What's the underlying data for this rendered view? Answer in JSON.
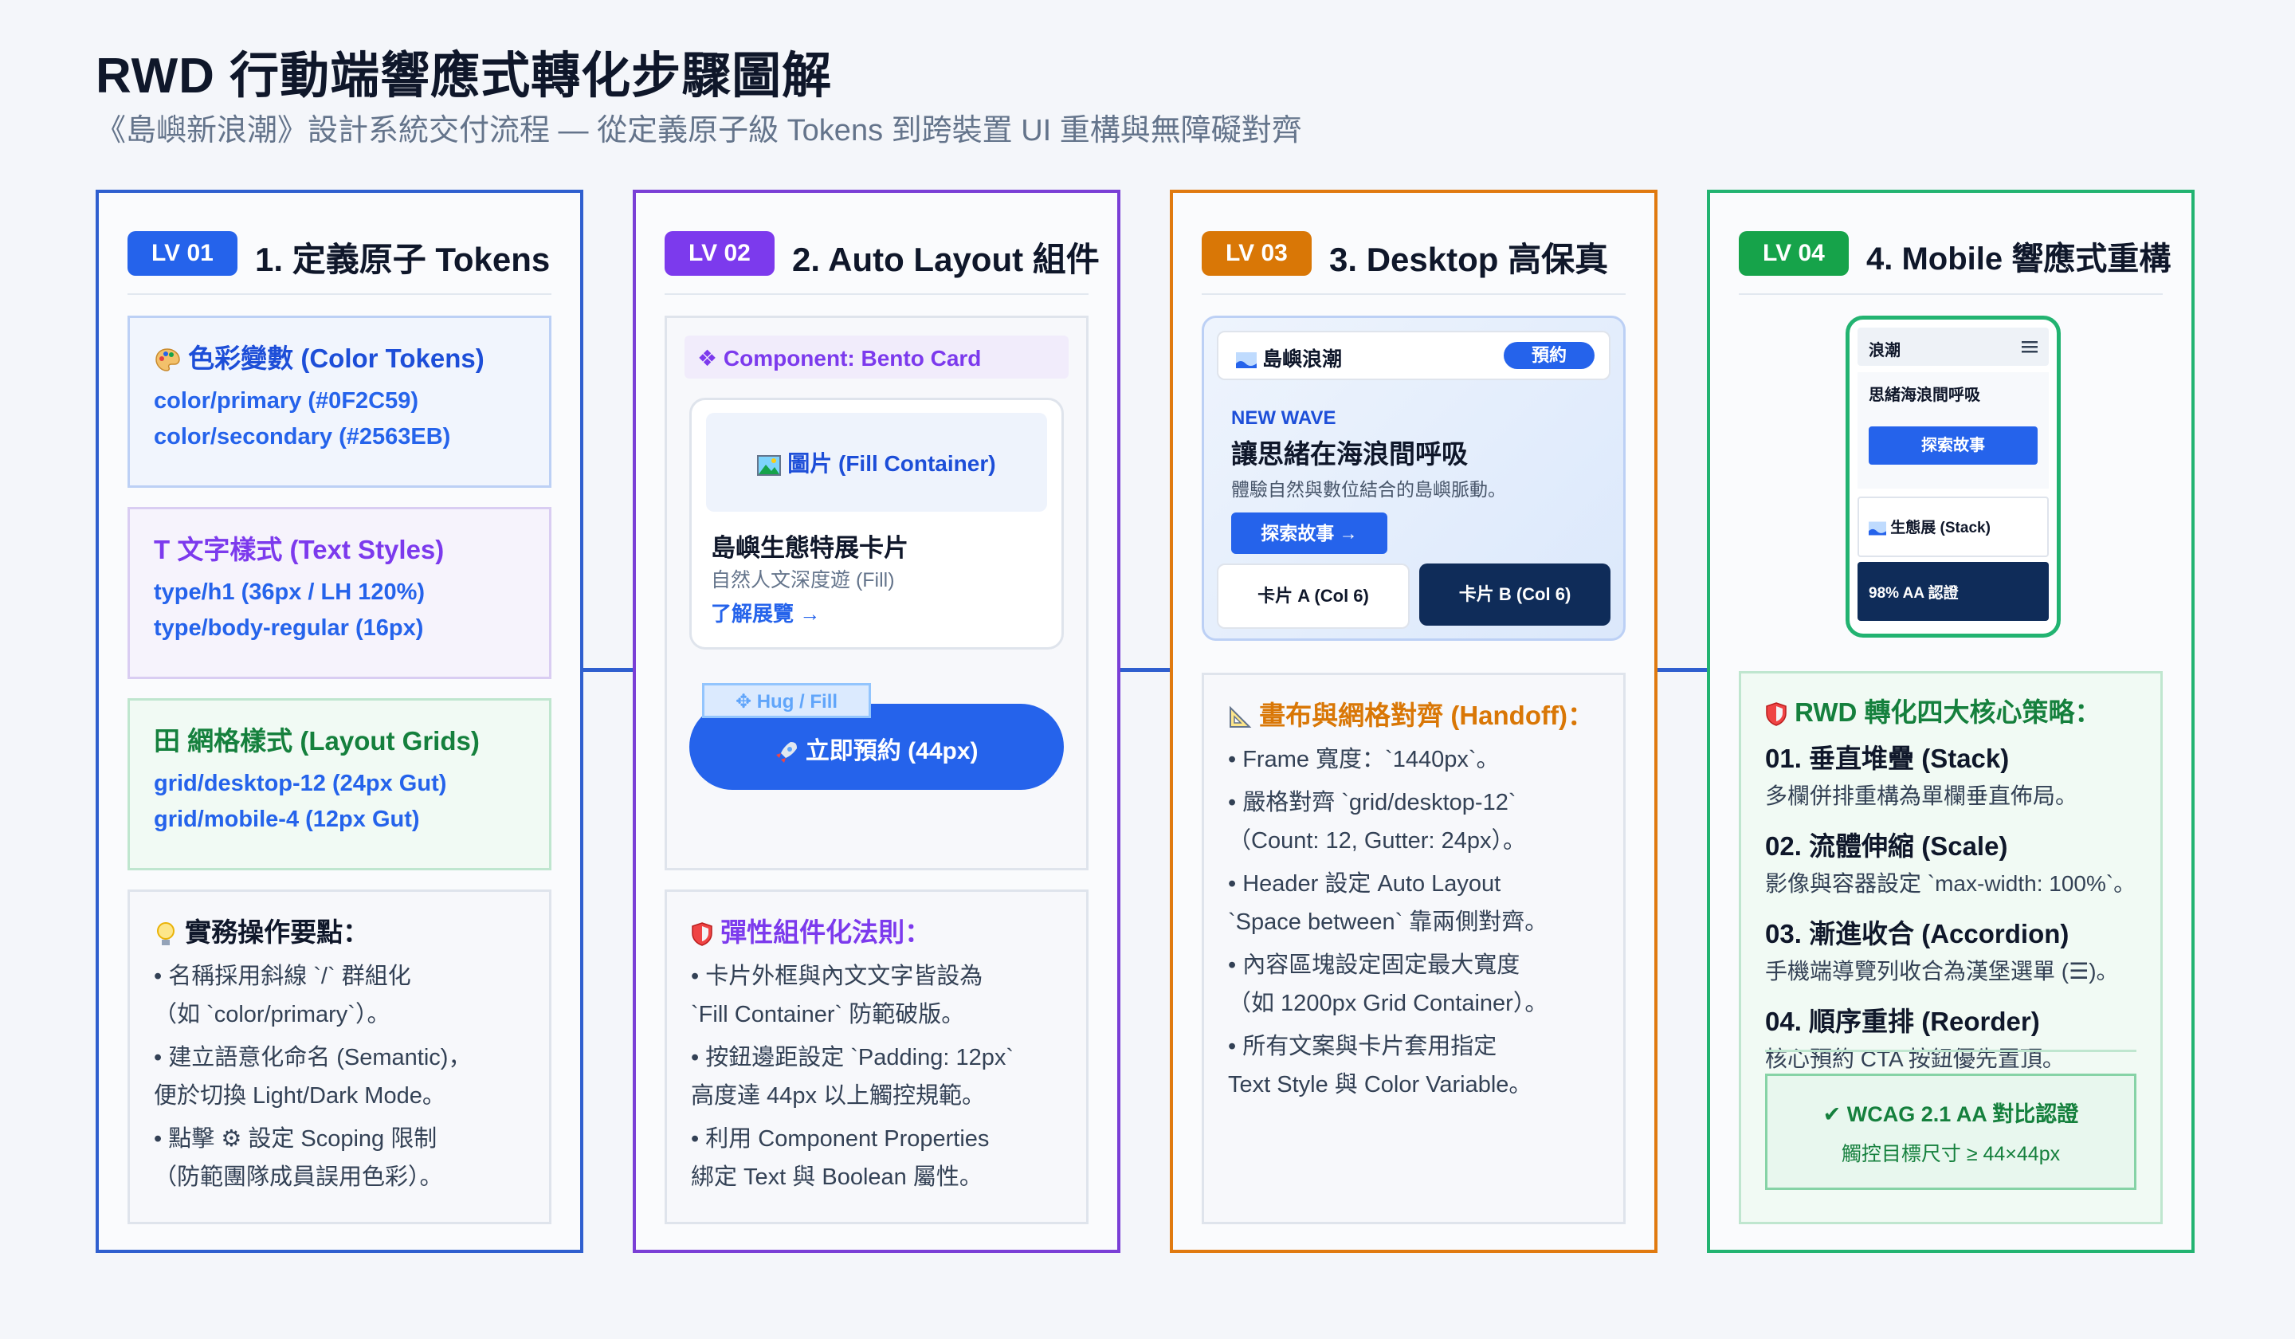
{
  "header": {
    "title": "RWD 行動端響應式轉化步驟圖解",
    "subtitle": "《島嶼新浪潮》設計系統交付流程 — 從定義原子級 Tokens 到跨裝置 UI 重構與無障礙對齊"
  },
  "colors": {
    "blue": "#2563eb",
    "purple": "#7c3aed",
    "orange": "#e07a10",
    "green": "#16a34a",
    "navy": "#0f2c59"
  },
  "panels": [
    {
      "badge": "LV 01",
      "title": "1. 定義原子 Tokens",
      "color_box": {
        "icon": "palette-icon",
        "title": "色彩變數 (Color Tokens)",
        "line1": "color/primary (#0F2C59)",
        "line2": "color/secondary (#2563EB)"
      },
      "text_box": {
        "icon": "text-t-icon",
        "title": "T 文字樣式 (Text Styles)",
        "line1": "type/h1 (36px / LH 120%)",
        "line2": "type/body-regular (16px)"
      },
      "grid_box": {
        "icon": "grid-icon",
        "title": "田 網格樣式 (Layout Grids)",
        "line1": "grid/desktop-12 (24px Gut)",
        "line2": "grid/mobile-4 (12px Gut)"
      },
      "tips": {
        "title": "實務操作要點：",
        "lines": [
          "• 名稱採用斜線 `/` 群組化",
          "（如 `color/primary`）。",
          "• 建立語意化命名 (Semantic)，",
          "便於切換 Light/Dark Mode。",
          "• 點擊 ⚙ 設定 Scoping 限制",
          "（防範團隊成員誤用色彩）。"
        ]
      }
    },
    {
      "badge": "LV 02",
      "title": "2. Auto Layout 組件",
      "component_label": "❖ Component: Bento Card",
      "image_label": "圖片 (Fill Container)",
      "card_title": "島嶼生態特展卡片",
      "card_sub": "自然人文深度遊 (Fill)",
      "card_link": "了解展覽 →",
      "hug_tag": "✥ Hug / Fill",
      "cta": "立即預約 (44px)",
      "rules": {
        "title": "彈性組件化法則：",
        "lines": [
          "• 卡片外框與內文文字皆設為",
          "`Fill Container` 防範破版。",
          "• 按鈕邊距設定 `Padding: 12px`",
          "高度達 44px 以上觸控規範。",
          "• 利用 Component Properties",
          "綁定 Text 與 Boolean 屬性。"
        ]
      }
    },
    {
      "badge": "LV 03",
      "title": "3. Desktop 高保真",
      "nav_brand": "島嶼浪潮",
      "nav_button": "預約",
      "hero_kicker": "NEW WAVE",
      "hero_title": "讓思緒在海浪間呼吸",
      "hero_sub": "體驗自然與數位結合的島嶼脈動。",
      "hero_button": "探索故事 →",
      "card_a": "卡片 A (Col 6)",
      "card_b": "卡片 B (Col 6)",
      "handoff": {
        "title": "畫布與網格對齊 (Handoff)：",
        "lines": [
          "• Frame 寬度：`1440px`。",
          "• 嚴格對齊 `grid/desktop-12`",
          "（Count: 12, Gutter: 24px）。",
          "• Header 設定 Auto Layout",
          "`Space between` 靠兩側對齊。",
          "• 內容區塊設定固定最大寬度",
          "（如 1200px Grid Container）。",
          "• 所有文案與卡片套用指定",
          "Text Style 與 Color Variable。"
        ]
      }
    },
    {
      "badge": "LV 04",
      "title": "4. Mobile 響應式重構",
      "phone": {
        "brand": "浪潮",
        "hero": "思緒海浪間呼吸",
        "button": "探索故事",
        "stack": "生態展 (Stack)",
        "aa": "98% AA 認證"
      },
      "strategy": {
        "title": "RWD 轉化四大核心策略：",
        "items": [
          {
            "h": "01. 垂直堆疊 (Stack)",
            "d": "多欄併排重構為單欄垂直佈局。"
          },
          {
            "h": "02. 流體伸縮 (Scale)",
            "d": "影像與容器設定 `max-width: 100%`。"
          },
          {
            "h": "03. 漸進收合 (Accordion)",
            "d": "手機端導覽列收合為漢堡選單 (☰)。"
          },
          {
            "h": "04. 順序重排 (Reorder)",
            "d": "核心預約 CTA 按鈕優先置頂。"
          }
        ],
        "wcag_title": "✔ WCAG 2.1 AA 對比認證",
        "wcag_sub": "觸控目標尺寸 ≥ 44×44px"
      }
    }
  ]
}
